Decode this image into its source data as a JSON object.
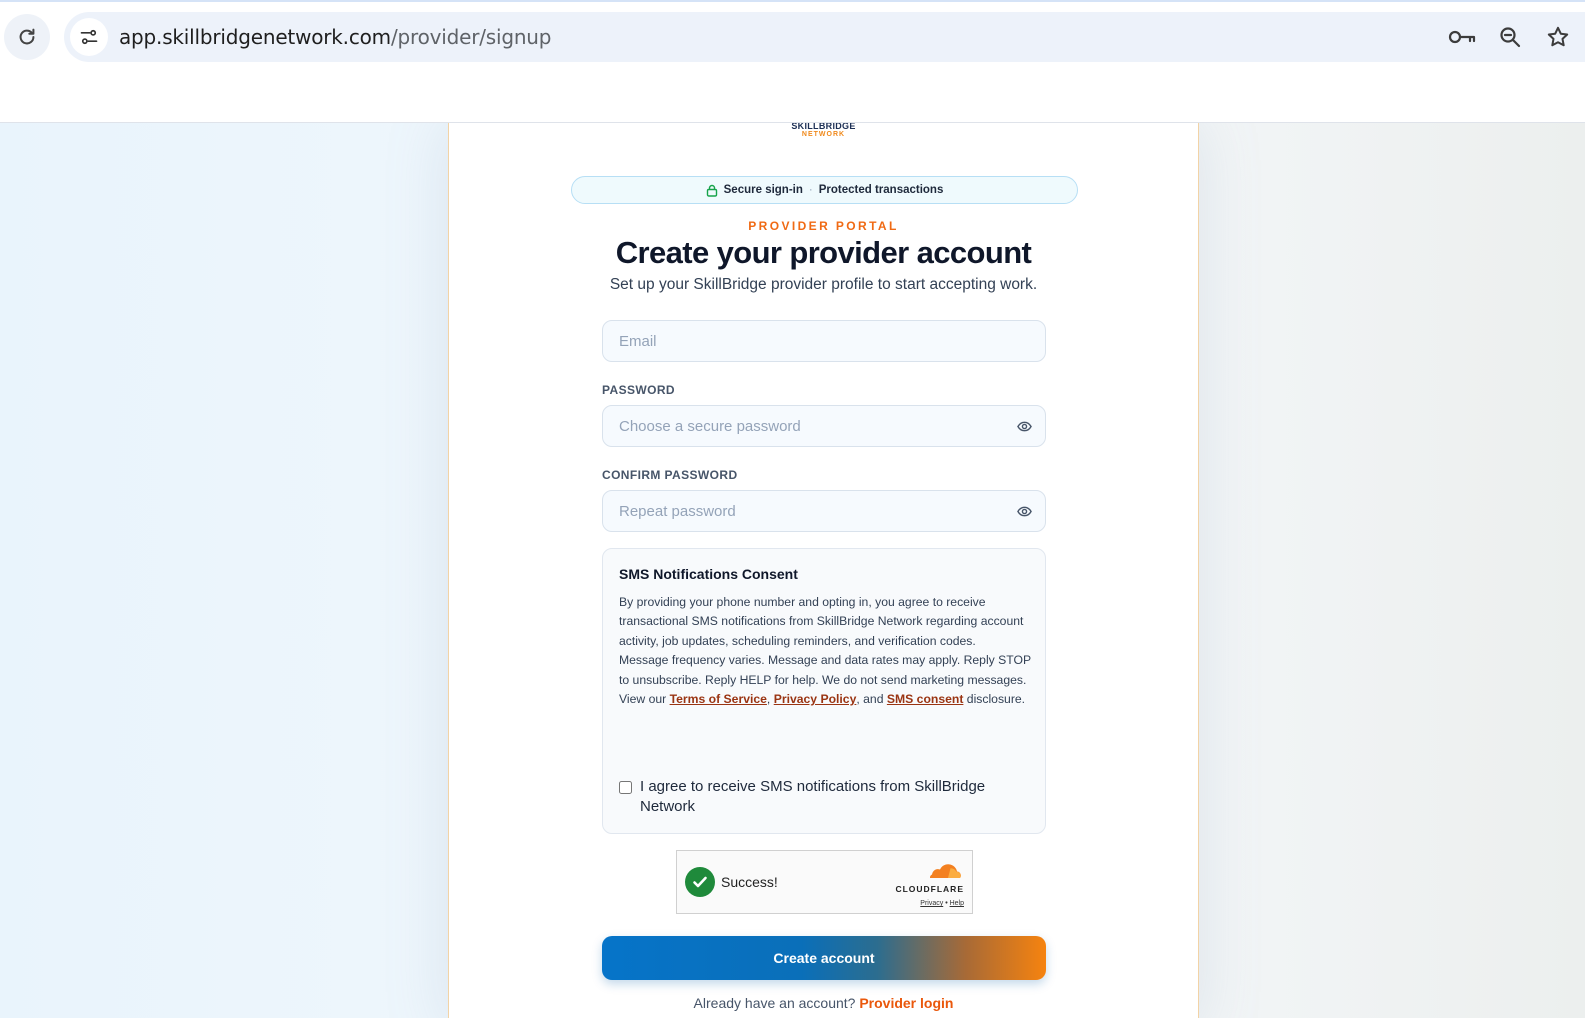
{
  "browser": {
    "url_host": "app.skillbridgenetwork.com",
    "url_path": "/provider/signup",
    "icons": [
      "reload-icon",
      "site-info-icon",
      "key-icon",
      "zoom-icon",
      "star-icon"
    ]
  },
  "brand": {
    "logo_top": "SKILLBRIDGE",
    "logo_bottom": "NETWORK"
  },
  "banner": {
    "secure": "Secure sign-in",
    "separator": "·",
    "protected": "Protected transactions"
  },
  "header": {
    "eyebrow": "PROVIDER PORTAL",
    "title": "Create your provider account",
    "subtitle": "Set up your SkillBridge provider profile to start accepting work."
  },
  "form": {
    "email_placeholder": "Email",
    "password_label": "PASSWORD",
    "password_placeholder": "Choose a secure password",
    "confirm_label": "CONFIRM PASSWORD",
    "confirm_placeholder": "Repeat password"
  },
  "consent": {
    "title": "SMS Notifications Consent",
    "para1": "By providing your phone number and opting in, you agree to receive transactional SMS notifications from SkillBridge Network regarding account activity, job updates, scheduling reminders, and verification codes.",
    "para2": "Message frequency varies. Message and data rates may apply. Reply STOP to unsubscribe. Reply HELP for help. We do not send marketing messages.",
    "view_prefix": "View our ",
    "terms_link": "Terms of Service",
    "comma": ", ",
    "privacy_link": "Privacy Policy",
    "and_text": ", and ",
    "sms_link": "SMS consent",
    "view_suffix": " disclosure.",
    "checkbox_label": "I agree to receive SMS notifications from SkillBridge Network"
  },
  "captcha": {
    "status": "Success!",
    "provider": "CLOUDFLARE",
    "privacy": "Privacy",
    "dot": "•",
    "help": "Help"
  },
  "actions": {
    "create_label": "Create account",
    "login_prompt": "Already have an account?",
    "login_link": "Provider login"
  },
  "colors": {
    "accent_orange": "#f06a14",
    "accent_blue": "#0674c9",
    "success_green": "#1f8a3b"
  }
}
